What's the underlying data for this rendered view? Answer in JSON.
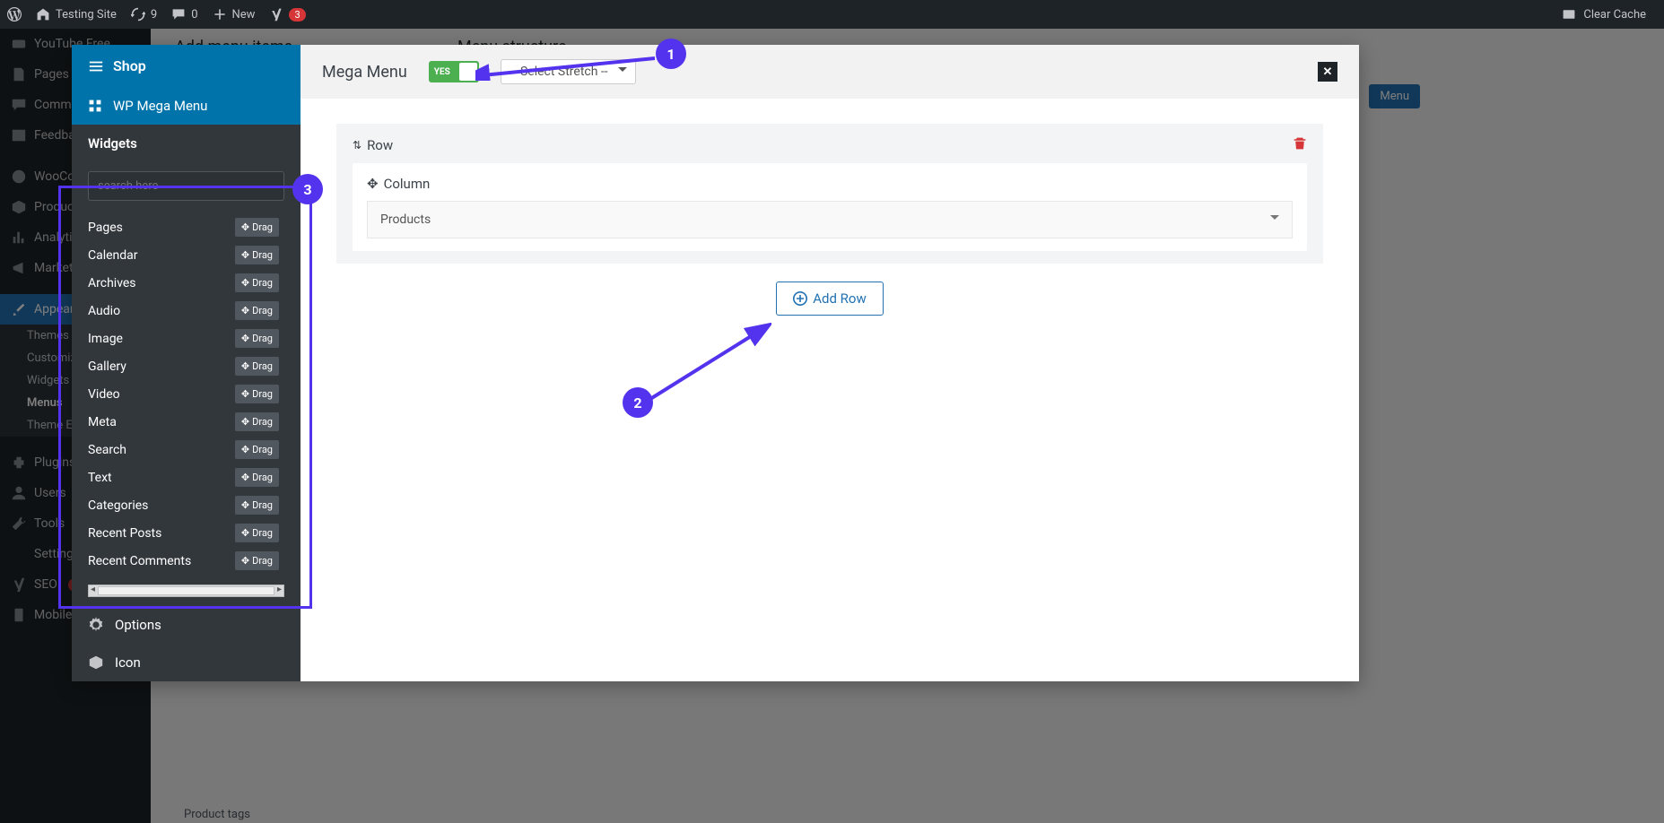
{
  "admin_bar": {
    "site_name": "Testing Site",
    "updates": "9",
    "comments": "0",
    "new_label": "New",
    "yoast_badge": "3",
    "clear_cache": "Clear Cache"
  },
  "wp_sidebar": {
    "items": [
      "YouTube Free",
      "Pages",
      "Comments",
      "Feedback",
      "WooCommerce",
      "Products",
      "Analytics",
      "Marketing",
      "Appearance"
    ],
    "appearance_sub": [
      "Themes",
      "Customize",
      "Widgets",
      "Menus",
      "Theme Editor"
    ],
    "lower": [
      "Plugins",
      "Users",
      "Tools",
      "Settings",
      "SEO",
      "Mobile Options"
    ]
  },
  "behind": {
    "left_heading": "Add menu items",
    "right_heading": "Menu structure",
    "save_menu": "Menu",
    "product_tags": "Product tags"
  },
  "modal": {
    "shop_header": "Shop",
    "tabs": {
      "mega_menu": "WP Mega Menu"
    },
    "widgets_label": "Widgets",
    "search_placeholder": "search here",
    "widget_items": [
      "Pages",
      "Calendar",
      "Archives",
      "Audio",
      "Image",
      "Gallery",
      "Video",
      "Meta",
      "Search",
      "Text",
      "Categories",
      "Recent Posts",
      "Recent Comments"
    ],
    "drag_label": "Drag",
    "bottom_tabs": {
      "options": "Options",
      "icon": "Icon"
    },
    "header": {
      "title": "Mega Menu",
      "toggle": "YES",
      "stretch_placeholder": "-- Select Stretch --"
    },
    "body": {
      "row_label": "Row",
      "column_label": "Column",
      "product_label": "Products",
      "add_row": "Add Row"
    }
  },
  "annotations": {
    "n1": "1",
    "n2": "2",
    "n3": "3"
  }
}
